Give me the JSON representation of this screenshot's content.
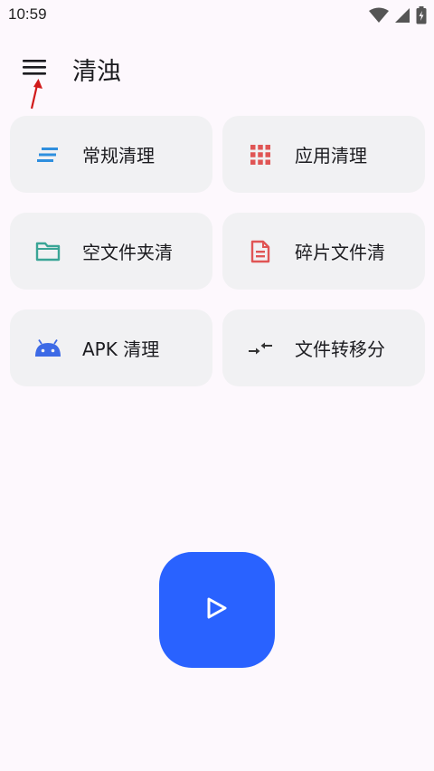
{
  "status_bar": {
    "time": "10:59"
  },
  "app_bar": {
    "title": "清浊"
  },
  "cards": [
    {
      "label": "常规清理",
      "icon": "lines-icon",
      "color": "#2f8fde"
    },
    {
      "label": "应用清理",
      "icon": "apps-grid-icon",
      "color": "#e05555"
    },
    {
      "label": "空文件夹清",
      "icon": "folder-icon",
      "color": "#3aa596"
    },
    {
      "label": "碎片文件清",
      "icon": "document-icon",
      "color": "#e05555"
    },
    {
      "label": "APK 清理",
      "icon": "android-icon",
      "color": "#3d6ae6"
    },
    {
      "label": "文件转移分",
      "icon": "transfer-arrows-icon",
      "color": "#333333"
    }
  ],
  "fab": {
    "icon": "play-icon",
    "color": "#2962ff"
  },
  "colors": {
    "background": "#fdf8fd",
    "card": "#f1f1f3",
    "annotation_arrow": "#d11a1a"
  }
}
